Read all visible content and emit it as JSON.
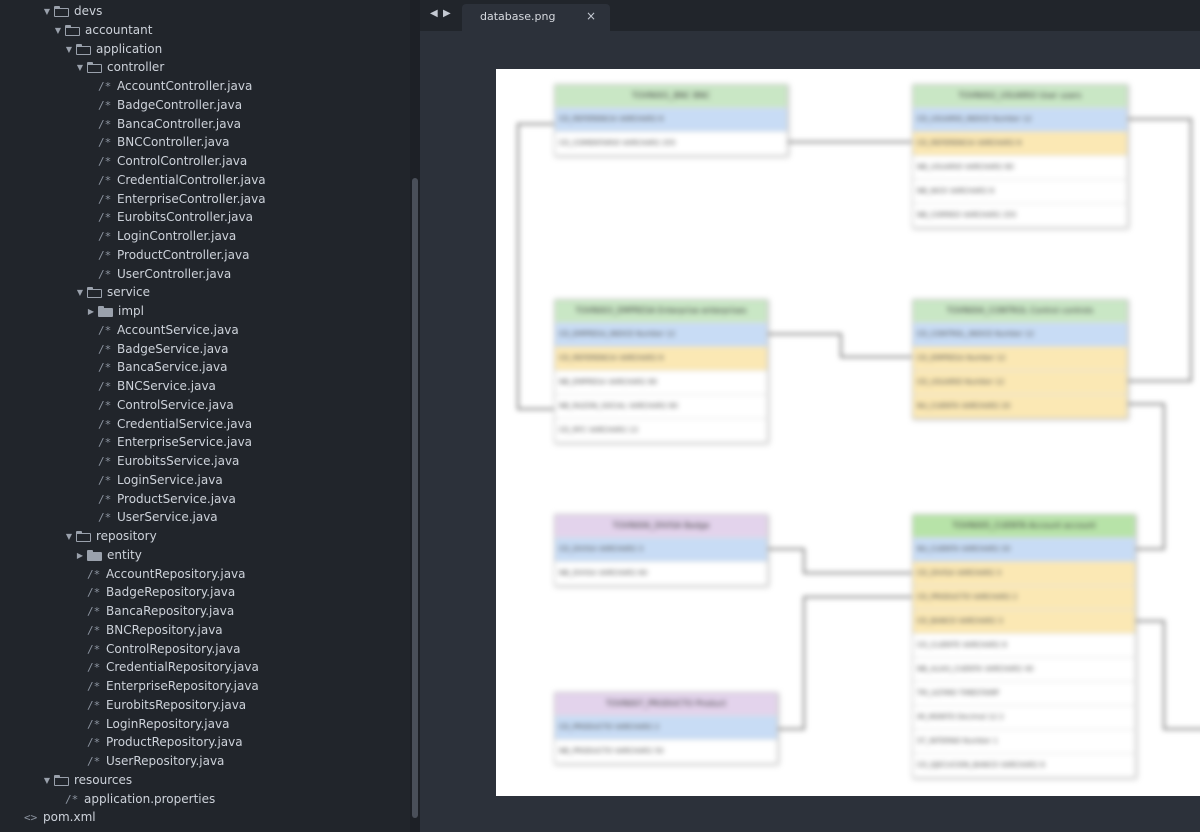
{
  "tree": [
    {
      "label": "devs",
      "kind": "folder",
      "open": true,
      "depth": 0
    },
    {
      "label": "accountant",
      "kind": "folder",
      "open": true,
      "depth": 1
    },
    {
      "label": "application",
      "kind": "folder",
      "open": true,
      "depth": 2
    },
    {
      "label": "controller",
      "kind": "folder",
      "open": true,
      "depth": 3
    },
    {
      "label": "AccountController.java",
      "kind": "java",
      "depth": 4
    },
    {
      "label": "BadgeController.java",
      "kind": "java",
      "depth": 4
    },
    {
      "label": "BancaController.java",
      "kind": "java",
      "depth": 4
    },
    {
      "label": "BNCController.java",
      "kind": "java",
      "depth": 4
    },
    {
      "label": "ControlController.java",
      "kind": "java",
      "depth": 4
    },
    {
      "label": "CredentialController.java",
      "kind": "java",
      "depth": 4
    },
    {
      "label": "EnterpriseController.java",
      "kind": "java",
      "depth": 4
    },
    {
      "label": "EurobitsController.java",
      "kind": "java",
      "depth": 4
    },
    {
      "label": "LoginController.java",
      "kind": "java",
      "depth": 4
    },
    {
      "label": "ProductController.java",
      "kind": "java",
      "depth": 4
    },
    {
      "label": "UserController.java",
      "kind": "java",
      "depth": 4
    },
    {
      "label": "service",
      "kind": "folder",
      "open": true,
      "depth": 3
    },
    {
      "label": "impl",
      "kind": "folder",
      "open": false,
      "depth": 4
    },
    {
      "label": "AccountService.java",
      "kind": "java",
      "depth": 4
    },
    {
      "label": "BadgeService.java",
      "kind": "java",
      "depth": 4
    },
    {
      "label": "BancaService.java",
      "kind": "java",
      "depth": 4
    },
    {
      "label": "BNCService.java",
      "kind": "java",
      "depth": 4
    },
    {
      "label": "ControlService.java",
      "kind": "java",
      "depth": 4
    },
    {
      "label": "CredentialService.java",
      "kind": "java",
      "depth": 4
    },
    {
      "label": "EnterpriseService.java",
      "kind": "java",
      "depth": 4
    },
    {
      "label": "EurobitsService.java",
      "kind": "java",
      "depth": 4
    },
    {
      "label": "LoginService.java",
      "kind": "java",
      "depth": 4
    },
    {
      "label": "ProductService.java",
      "kind": "java",
      "depth": 4
    },
    {
      "label": "UserService.java",
      "kind": "java",
      "depth": 4
    },
    {
      "label": "repository",
      "kind": "folder",
      "open": true,
      "depth": 2
    },
    {
      "label": "entity",
      "kind": "folder",
      "open": false,
      "depth": 3
    },
    {
      "label": "AccountRepository.java",
      "kind": "java",
      "depth": 3
    },
    {
      "label": "BadgeRepository.java",
      "kind": "java",
      "depth": 3
    },
    {
      "label": "BancaRepository.java",
      "kind": "java",
      "depth": 3
    },
    {
      "label": "BNCRepository.java",
      "kind": "java",
      "depth": 3
    },
    {
      "label": "ControlRepository.java",
      "kind": "java",
      "depth": 3
    },
    {
      "label": "CredentialRepository.java",
      "kind": "java",
      "depth": 3
    },
    {
      "label": "EnterpriseRepository.java",
      "kind": "java",
      "depth": 3
    },
    {
      "label": "EurobitsRepository.java",
      "kind": "java",
      "depth": 3
    },
    {
      "label": "LoginRepository.java",
      "kind": "java",
      "depth": 3
    },
    {
      "label": "ProductRepository.java",
      "kind": "java",
      "depth": 3
    },
    {
      "label": "UserRepository.java",
      "kind": "java",
      "depth": 3
    },
    {
      "label": "resources",
      "kind": "folder",
      "open": true,
      "depth": 0
    },
    {
      "label": "application.properties",
      "kind": "java",
      "depth": 1
    },
    {
      "label": "pom.xml",
      "kind": "xml",
      "depth": -1
    }
  ],
  "icons": {
    "java": "/*",
    "xml": "<>",
    "arrow_open": "▼",
    "arrow_closed": "▶",
    "nav_left": "◀",
    "nav_right": "▶",
    "close": "×"
  },
  "tab": {
    "label": "database.png",
    "close": "×"
  },
  "diagram_tables": [
    {
      "title": "TOVN001_BNC BNC",
      "color": "green",
      "rows": [
        {
          "t": "CD_REFERENCIA VARCHAR2 6",
          "k": "pk"
        },
        {
          "t": "CD_COMENTARIO VARCHAR2 255",
          "k": "plain"
        }
      ]
    },
    {
      "title": "TOVN002_USUARIO User users",
      "color": "green",
      "rows": [
        {
          "t": "CD_USUARIO_INDICE Number 12",
          "k": "pk"
        },
        {
          "t": "CD_REFERENCIA VARCHAR2 6",
          "k": "fk"
        },
        {
          "t": "NB_USUARIO VARCHAR2 80",
          "k": "plain"
        },
        {
          "t": "NB_NICK VARCHAR2 8",
          "k": "plain"
        },
        {
          "t": "NB_CORREO VARCHAR2 255",
          "k": "plain"
        }
      ]
    },
    {
      "title": "TOVN003_EMPRESA Enterprise enterprises",
      "color": "green",
      "rows": [
        {
          "t": "CD_EMPRESA_INDICE Number 12",
          "k": "pk"
        },
        {
          "t": "CD_REFERENCIA VARCHAR2 6",
          "k": "fk"
        },
        {
          "t": "NB_EMPRESA VARCHAR2 80",
          "k": "plain"
        },
        {
          "t": "NB_RAZON_SOCIAL VARCHAR2 80",
          "k": "plain"
        },
        {
          "t": "CD_RFC VARCHAR2 13",
          "k": "plain"
        }
      ]
    },
    {
      "title": "TOVN004_CONTROL Control controls",
      "color": "green",
      "rows": [
        {
          "t": "CD_CONTROL_INDICE Number 12",
          "k": "pk"
        },
        {
          "t": "CD_EMPRESA Number 12",
          "k": "fk"
        },
        {
          "t": "CD_USUARIO Number 12",
          "k": "fk"
        },
        {
          "t": "NU_CUENTA VARCHAR2 20",
          "k": "fk"
        }
      ]
    },
    {
      "title": "TOVN006_DIVISA Badge",
      "color": "purple",
      "rows": [
        {
          "t": "CD_DIVISA VARCHAR2 3",
          "k": "pk"
        },
        {
          "t": "NB_DIVISA VARCHAR2 60",
          "k": "plain"
        }
      ]
    },
    {
      "title": "TOVN005_CUENTA Account account",
      "color": "lime",
      "rows": [
        {
          "t": "NU_CUENTA VARCHAR2 20",
          "k": "pk"
        },
        {
          "t": "CD_DIVISA VARCHAR2 3",
          "k": "fk"
        },
        {
          "t": "CD_PRODUCTO VARCHAR2 2",
          "k": "fk"
        },
        {
          "t": "CD_BANCO VARCHAR2 3",
          "k": "fk"
        },
        {
          "t": "CD_CLIENTE VARCHAR2 8",
          "k": "plain"
        },
        {
          "t": "NB_ALIAS_CUENTA VARCHAR2 40",
          "k": "plain"
        },
        {
          "t": "TM_ULTIMO TIMESTAMP",
          "k": "plain"
        },
        {
          "t": "IM_MONTO Decimal 12 2",
          "k": "plain"
        },
        {
          "t": "ST_INTERNO Number 1",
          "k": "plain"
        },
        {
          "t": "CD_EJECUCION_BANCO VARCHAR2 6",
          "k": "plain"
        }
      ]
    },
    {
      "title": "TOVN007_PRODUCTO Product",
      "color": "purple",
      "rows": [
        {
          "t": "CD_PRODUCTO VARCHAR2 2",
          "k": "pk"
        },
        {
          "t": "NB_PRODUCTO VARCHAR2 50",
          "k": "plain"
        }
      ]
    }
  ]
}
